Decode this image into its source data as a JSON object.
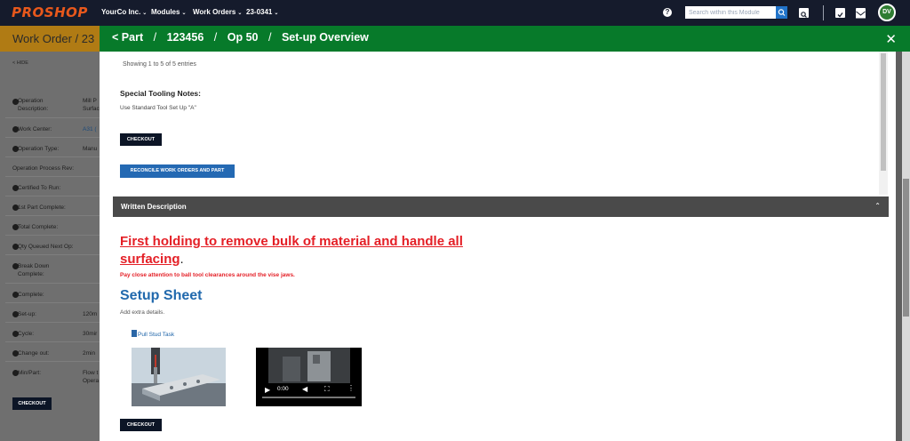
{
  "topnav": {
    "logo": "PROSHOP",
    "items": [
      {
        "label": "YourCo Inc."
      },
      {
        "label": "Modules"
      },
      {
        "label": "Work Orders"
      },
      {
        "label": "23-0341"
      }
    ],
    "search_placeholder": "Search within this Module",
    "avatar_initials": "DV"
  },
  "background": {
    "title": "Work Order  /  23",
    "hide_link": "< HIDE",
    "rows": [
      {
        "label": "Operation Description:",
        "value": "Mill P\nSurfac"
      },
      {
        "label": "Work Center:",
        "value": "A31 ("
      },
      {
        "label": "Operation Type:",
        "value": "Manu"
      },
      {
        "label": "Operation Process Rev:",
        "value": ""
      },
      {
        "label": "Certified To Run:",
        "value": ""
      },
      {
        "label": "1st Part Complete:",
        "value": ""
      },
      {
        "label": "Total Complete:",
        "value": ""
      },
      {
        "label": "Qty Queued Next Op:",
        "value": ""
      },
      {
        "label": "Break Down Complete:",
        "value": ""
      },
      {
        "label": "Complete:",
        "value": ""
      },
      {
        "label": "Set-up:",
        "value": "120m"
      },
      {
        "label": "Cycle:",
        "value": "30mir"
      },
      {
        "label": "Change out:",
        "value": "2min"
      },
      {
        "label": "Min/Part:",
        "value": "Flow t\nOpera"
      }
    ],
    "checkout_label": "CHECKOUT"
  },
  "modal": {
    "breadcrumb": [
      "Part",
      "123456",
      "Op 50",
      "Set-up Overview"
    ],
    "showing": "Showing 1 to 5 of 5 entries",
    "special_tooling_heading": "Special Tooling Notes:",
    "special_tooling_text": "Use Standard Tool Set Up \"A\"",
    "checkout_label": "CHECKOUT",
    "reconcile_label": "RECONCILE WORK ORDERS AND PART",
    "written_description_title": "Written Description",
    "red_heading": "First holding to remove bulk of material and handle all surfacing",
    "red_heading_end": ".",
    "red_note": "Pay close attention to ball tool clearances around the vise jaws.",
    "setup_sheet_title": "Setup Sheet",
    "setup_sheet_sub": "Add extra details.",
    "pdf_link": "Pull Stud Task",
    "video_time": "0:00",
    "checkout_bottom_label": "CHECKOUT"
  }
}
